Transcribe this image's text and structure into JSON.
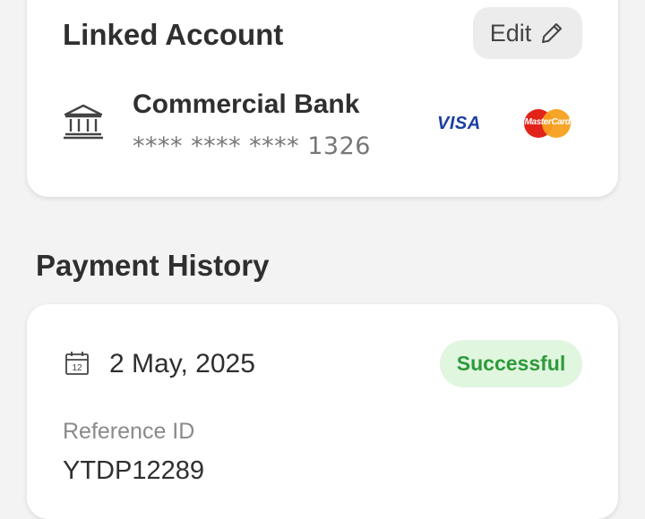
{
  "linked_account": {
    "title": "Linked Account",
    "edit_label": "Edit",
    "bank_name": "Commercial Bank",
    "masked_number": "**** **** **** 1326",
    "card_brands": {
      "visa": "VISA",
      "mastercard": "MasterCard"
    }
  },
  "payment_history": {
    "title": "Payment History",
    "items": [
      {
        "date": "2 May, 2025",
        "calendar_day": "12",
        "status": "Successful",
        "reference_label": "Reference ID",
        "reference_id": "YTDP12289"
      }
    ]
  },
  "colors": {
    "background": "#f3f3f3",
    "card": "#ffffff",
    "success_text": "#2e9a3a",
    "success_bg": "#e0f6df"
  }
}
